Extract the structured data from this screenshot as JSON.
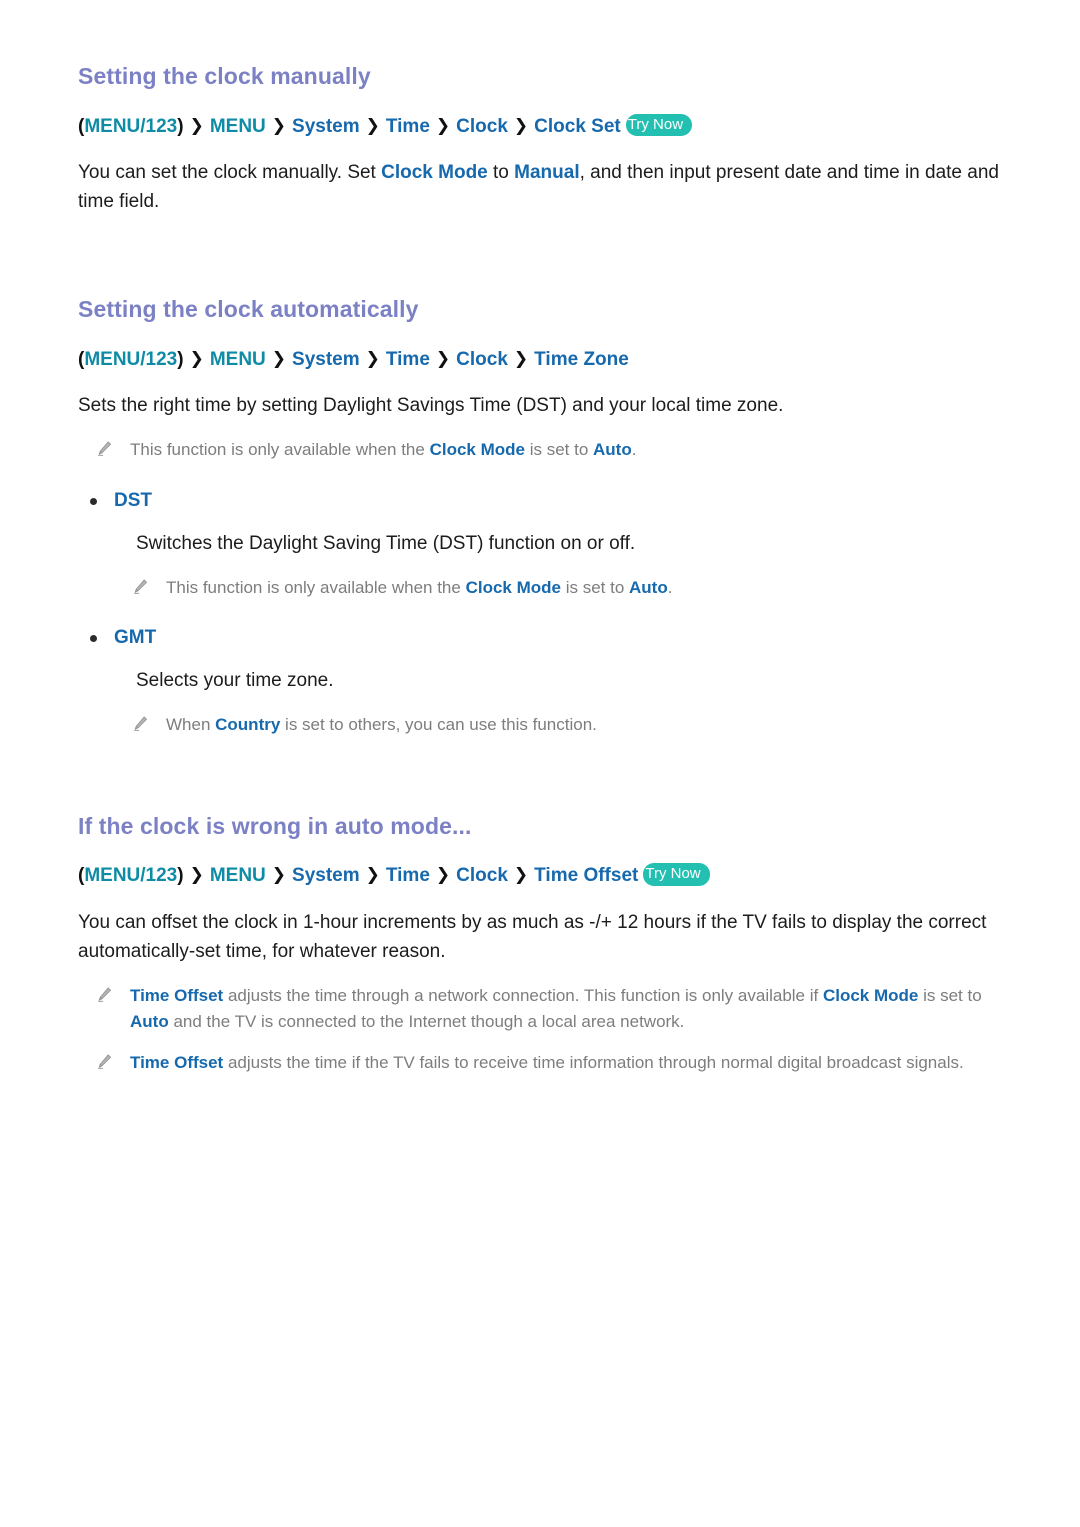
{
  "document": {
    "type": "e-manual-page",
    "background_color": "#ffffff",
    "heading_color": "#7b81c4",
    "link_color": "#1769ad",
    "menu_color": "#0e8ca6",
    "note_color": "#7d7d7d",
    "badge_color": "#23bfb0"
  },
  "sections": [
    {
      "title": "Setting the clock manually",
      "breadcrumb": {
        "open_paren": "(",
        "menu_key": "MENU/123",
        "close_paren": ")",
        "separator": "❯",
        "items": [
          "MENU",
          "System",
          "Time",
          "Clock",
          "Clock Set"
        ],
        "badge": "Try Now"
      },
      "body": {
        "part1": "You can set the clock manually. Set ",
        "hl1": "Clock Mode",
        "part2": " to ",
        "hl2": "Manual",
        "part3": ", and then input present date and time in date and time field."
      }
    },
    {
      "title": "Setting the clock automatically",
      "breadcrumb": {
        "open_paren": "(",
        "menu_key": "MENU/123",
        "close_paren": ")",
        "separator": "❯",
        "items": [
          "MENU",
          "System",
          "Time",
          "Clock",
          "Time Zone"
        ],
        "badge": ""
      },
      "body": {
        "part1": "Sets the right time by setting Daylight Savings Time (DST) and your local time zone."
      },
      "note": {
        "part1": "This function is only available when the ",
        "hl1": "Clock Mode",
        "part2": " is set to ",
        "hl2": "Auto",
        "part3": "."
      },
      "options": [
        {
          "name": "DST",
          "description": "Switches the Daylight Saving Time (DST) function on or off.",
          "note": {
            "part1": "This function is only available when the ",
            "hl1": "Clock Mode",
            "part2": " is set to ",
            "hl2": "Auto",
            "part3": "."
          }
        },
        {
          "name": "GMT",
          "description": "Selects your time zone.",
          "note": {
            "part1": "When ",
            "hl1": "Country",
            "part2": " is set to others, you can use this function.",
            "hl2": "",
            "part3": ""
          }
        }
      ]
    },
    {
      "title": "If the clock is wrong in auto mode...",
      "breadcrumb": {
        "open_paren": "(",
        "menu_key": "MENU/123",
        "close_paren": ")",
        "separator": "❯",
        "items": [
          "MENU",
          "System",
          "Time",
          "Clock",
          "Time Offset"
        ],
        "badge": "Try Now"
      },
      "body": {
        "part1": "You can offset the clock in 1-hour increments by as much as -/+ 12 hours if the TV fails to display the correct automatically-set time, for whatever reason."
      },
      "notes": [
        {
          "hl0": "Time Offset",
          "part1": " adjusts the time through a network connection. This function is only available if ",
          "hl1": "Clock Mode",
          "part2": " is set to ",
          "hl2": "Auto",
          "part3": " and the TV is connected to the Internet though a local area network."
        },
        {
          "hl0": "Time Offset",
          "part1": " adjusts the time if the TV fails to receive time information through normal digital broadcast signals.",
          "hl1": "",
          "part2": "",
          "hl2": "",
          "part3": ""
        }
      ]
    }
  ],
  "icons": {
    "pencil": "pencil-icon",
    "bullet": "bullet-dot-icon",
    "chevron": "chevron-right-icon"
  }
}
